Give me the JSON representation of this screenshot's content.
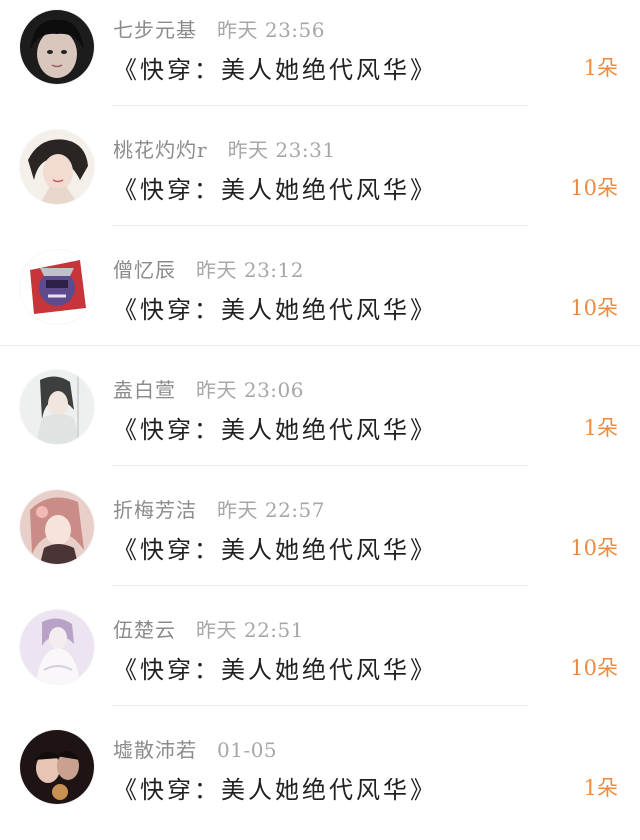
{
  "accent_color": "#ef8a43",
  "rows": [
    {
      "user": "七步元基",
      "time": "昨天 23:56",
      "book": "《快穿：美人她绝代风华》",
      "count": "1朵"
    },
    {
      "user": "桃花灼灼r",
      "time": "昨天 23:31",
      "book": "《快穿：美人她绝代风华》",
      "count": "10朵"
    },
    {
      "user": "僧忆辰",
      "time": "昨天 23:12",
      "book": "《快穿：美人她绝代风华》",
      "count": "10朵"
    },
    {
      "user": "盍白萱",
      "time": "昨天 23:06",
      "book": "《快穿：美人她绝代风华》",
      "count": "1朵"
    },
    {
      "user": "折梅芳洁",
      "time": "昨天 22:57",
      "book": "《快穿：美人她绝代风华》",
      "count": "10朵"
    },
    {
      "user": "伍楚云",
      "time": "昨天 22:51",
      "book": "《快穿：美人她绝代风华》",
      "count": "10朵"
    },
    {
      "user": "墟散沛若",
      "time": "01-05",
      "book": "《快穿：美人她绝代风华》",
      "count": "1朵"
    }
  ]
}
